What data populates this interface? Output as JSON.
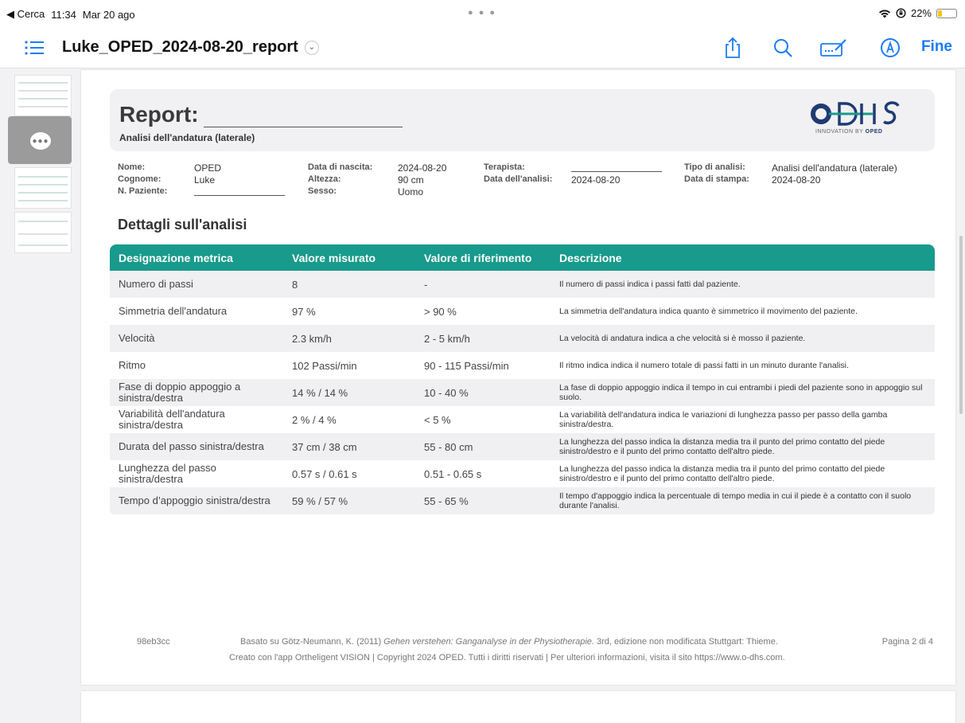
{
  "status_bar": {
    "back_label": "◀ Cerca",
    "time": "11:34",
    "date": "Mar 20 ago",
    "battery": "22%",
    "battery_level": 0.22
  },
  "nav": {
    "title": "Luke_OPED_2024-08-20_report",
    "done_label": "Fine"
  },
  "report": {
    "title": "Report:",
    "subtitle": "Analisi dell'andatura (laterale)",
    "logo_text": "INNOVATION BY OPED",
    "logo_bold": "OPED",
    "patient": {
      "nome_label": "Nome:",
      "nome": "OPED",
      "cognome_label": "Cognome:",
      "cognome": "Luke",
      "npaziente_label": "N. Paziente:",
      "nascita_label": "Data di nascita:",
      "nascita": "2024-08-20",
      "altezza_label": "Altezza:",
      "altezza": "90 cm",
      "sesso_label": "Sesso:",
      "sesso": "Uomo",
      "terapista_label": "Terapista:",
      "data_analisi_label": "Data dell'analisi:",
      "data_analisi": "2024-08-20",
      "tipo_label": "Tipo di analisi:",
      "tipo": "Analisi dell'andatura (laterale)",
      "stampa_label": "Data di stampa:",
      "stampa": "2024-08-20"
    },
    "section_title": "Dettagli sull'analisi",
    "columns": [
      "Designazione metrica",
      "Valore misurato",
      "Valore di riferimento",
      "Descrizione"
    ],
    "rows": [
      {
        "metric": "Numero di passi",
        "measured": "8",
        "reference": "-",
        "description": "Il numero di passi indica i passi fatti dal paziente."
      },
      {
        "metric": "Simmetria dell'andatura",
        "measured": "97 %",
        "reference": "> 90 %",
        "description": "La simmetria dell'andatura indica quanto è simmetrico il movimento del paziente."
      },
      {
        "metric": "Velocità",
        "measured": "2.3 km/h",
        "reference": "2 - 5 km/h",
        "description": "La velocità di andatura indica a che velocità si è mosso il paziente."
      },
      {
        "metric": "Ritmo",
        "measured": "102 Passi/min",
        "reference": "90 - 115 Passi/min",
        "description": "Il ritmo indica indica il numero totale di passi fatti in un minuto durante l'analisi."
      },
      {
        "metric": "Fase di doppio appoggio a sinistra/destra",
        "measured": "14 % / 14 %",
        "reference": "10 - 40 %",
        "description": "La fase di doppio appoggio indica il tempo in cui entrambi i piedi del paziente sono in appoggio sul suolo."
      },
      {
        "metric": "Variabilità dell'andatura sinistra/destra",
        "measured": "2 % / 4 %",
        "reference": "< 5 %",
        "description": "La variabilità dell'andatura indica le variazioni di lunghezza passo per passo della gamba sinistra/destra."
      },
      {
        "metric": "Durata del passo sinistra/destra",
        "measured": "37 cm / 38 cm",
        "reference": "55 - 80 cm",
        "description": "La lunghezza del passo indica la distanza media tra il punto del primo contatto del piede sinistro/destro e il punto del primo contatto dell'altro piede."
      },
      {
        "metric": "Lunghezza del passo sinistra/destra",
        "measured": "0.57 s / 0.61 s",
        "reference": "0.51 - 0.65 s",
        "description": "La lunghezza del passo indica la distanza media tra il punto del primo contatto del piede sinistro/destro e il punto del primo contatto dell'altro piede."
      },
      {
        "metric": "Tempo d’appoggio sinistra/destra",
        "measured": "59 % / 57 %",
        "reference": "55 - 65 %",
        "description": "Il tempo d'appoggio indica la percentuale di tempo media in cui il piede è a contatto con il suolo durante l'analisi."
      }
    ],
    "footer": {
      "id": "98eb3cc",
      "source_prefix": "Basato su Götz-Neumann, K. (2011) ",
      "source_italic": "Gehen verstehen: Ganganalyse in der Physiotherapie.",
      "source_suffix": " 3rd, edizione non modificata Stuttgart: Thieme.",
      "copyright": "Creato con l'app Ortheligent VISION | Copyright 2024 OPED. Tutti i diritti riservati | Per ulteriori informazioni, visita il sito https://www.o-dhs.com.",
      "page": "Pagina 2 di 4"
    }
  },
  "colors": {
    "accent": "#1a7cf5",
    "table_header": "#189a8c",
    "logo_blue": "#1f3b73",
    "logo_teal": "#189a8c"
  }
}
